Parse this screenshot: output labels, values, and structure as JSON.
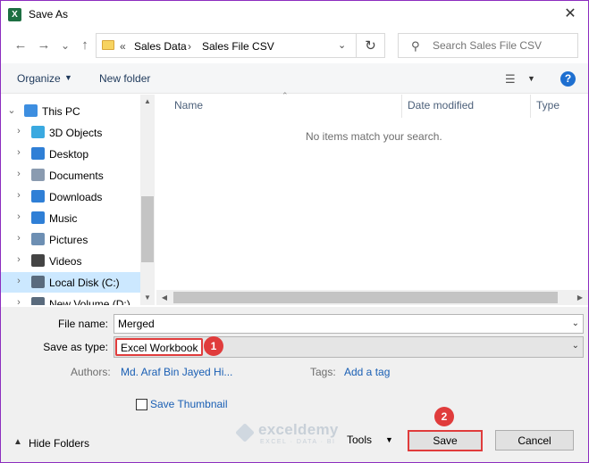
{
  "window": {
    "title": "Save As",
    "app_icon_letter": "X"
  },
  "nav": {
    "back_glyph": "←",
    "forward_glyph": "→",
    "recent_glyph": "⌄",
    "up_glyph": "↑",
    "breadcrumb_prefix": "«",
    "breadcrumb": [
      "Sales Data",
      "Sales File CSV"
    ],
    "breadcrumb_sep": "›",
    "refresh_glyph": "↻",
    "search_placeholder": "Search Sales File CSV"
  },
  "toolbar": {
    "organize": "Organize",
    "new_folder": "New folder",
    "help": "?"
  },
  "tree": [
    {
      "label": "This PC",
      "icon": "pc-icon",
      "color": "#3d8ee0",
      "indent": 0,
      "expanded": true,
      "selected": false
    },
    {
      "label": "3D Objects",
      "icon": "cube-icon",
      "color": "#3aa9e0",
      "indent": 1,
      "expanded": false,
      "selected": false
    },
    {
      "label": "Desktop",
      "icon": "desktop-icon",
      "color": "#2f7fd6",
      "indent": 1,
      "expanded": false,
      "selected": false
    },
    {
      "label": "Documents",
      "icon": "documents-icon",
      "color": "#8a9bb0",
      "indent": 1,
      "expanded": false,
      "selected": false
    },
    {
      "label": "Downloads",
      "icon": "download-icon",
      "color": "#2f7fd6",
      "indent": 1,
      "expanded": false,
      "selected": false
    },
    {
      "label": "Music",
      "icon": "music-icon",
      "color": "#2f7fd6",
      "indent": 1,
      "expanded": false,
      "selected": false
    },
    {
      "label": "Pictures",
      "icon": "pictures-icon",
      "color": "#6d8fb3",
      "indent": 1,
      "expanded": false,
      "selected": false
    },
    {
      "label": "Videos",
      "icon": "videos-icon",
      "color": "#444",
      "indent": 1,
      "expanded": false,
      "selected": false
    },
    {
      "label": "Local Disk (C:)",
      "icon": "drive-icon",
      "color": "#5a6b7d",
      "indent": 1,
      "expanded": false,
      "selected": true
    },
    {
      "label": "New Volume (D:)",
      "icon": "drive-icon",
      "color": "#5a6b7d",
      "indent": 1,
      "expanded": false,
      "selected": false
    }
  ],
  "filelist": {
    "columns": [
      "Name",
      "Date modified",
      "Type"
    ],
    "empty_message": "No items match your search."
  },
  "form": {
    "file_name_label": "File name:",
    "file_name_value": "Merged",
    "save_type_label": "Save as type:",
    "save_type_value": "Excel Workbook",
    "authors_label": "Authors:",
    "authors_value": "Md. Araf Bin Jayed Hi...",
    "tags_label": "Tags:",
    "tags_value": "Add a tag",
    "thumbnail_label": "Save Thumbnail",
    "thumbnail_checked": false
  },
  "footer": {
    "hide_folders": "Hide Folders",
    "tools": "Tools",
    "save": "Save",
    "cancel": "Cancel"
  },
  "annotations": {
    "step1": "1",
    "step2": "2",
    "accent": "#e03c3c"
  },
  "watermark": {
    "name": "exceldemy",
    "tagline": "EXCEL · DATA · BI"
  }
}
